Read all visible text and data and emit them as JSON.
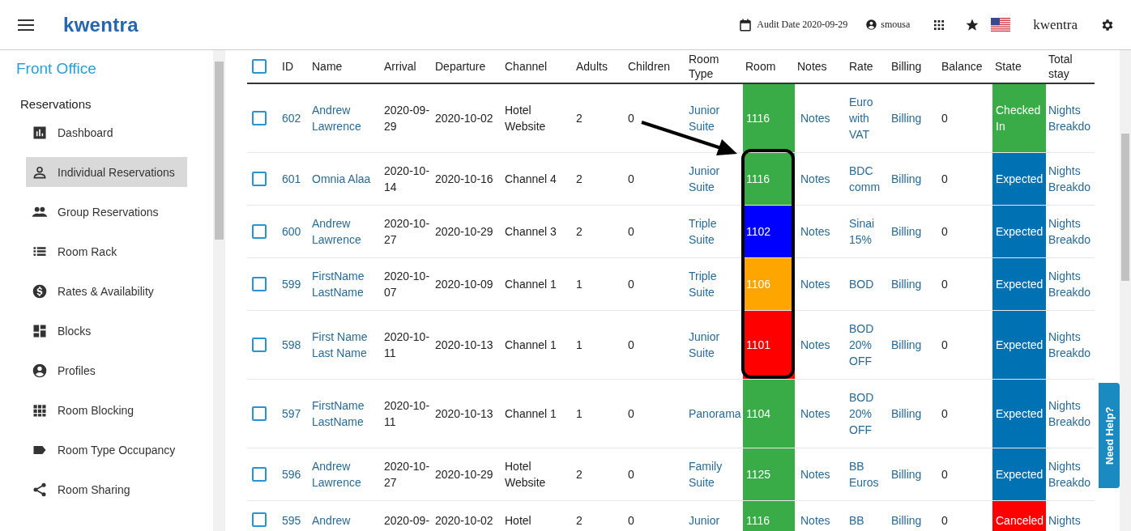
{
  "header": {
    "logo": "kwentra",
    "audit_date": "Audit Date 2020-09-29",
    "user": "smousa",
    "property": "kwentra"
  },
  "sidebar": {
    "section": "Front Office",
    "group": "Reservations",
    "items": [
      {
        "label": "Dashboard",
        "selected": false
      },
      {
        "label": "Individual Reservations",
        "selected": true
      },
      {
        "label": "Group Reservations",
        "selected": false
      },
      {
        "label": "Room Rack",
        "selected": false
      },
      {
        "label": "Rates & Availability",
        "selected": false
      },
      {
        "label": "Blocks",
        "selected": false
      },
      {
        "label": "Profiles",
        "selected": false
      },
      {
        "label": "Room Blocking",
        "selected": false
      },
      {
        "label": "Room Type Occupancy",
        "selected": false
      },
      {
        "label": "Room Sharing",
        "selected": false
      }
    ]
  },
  "table": {
    "select_all_checked": false,
    "columns": [
      "ID",
      "Name",
      "Arrival",
      "Departure",
      "Channel",
      "Adults",
      "Children",
      "Room Type",
      "Room",
      "Notes",
      "Rate",
      "Billing",
      "Balance",
      "State",
      "Total stay"
    ],
    "rows": [
      {
        "checked": false,
        "id": "602",
        "name": "Andrew Lawrence",
        "arrival": "2020-09-29",
        "departure": "2020-10-02",
        "channel": "Hotel Website",
        "adults": "2",
        "children": "0",
        "room_type": "Junior Suite",
        "room": "1116",
        "color": "#39ac48",
        "notes": "Notes",
        "rate": "Euro with VAT",
        "billing": "Billing",
        "balance": "0",
        "state": "Checked In",
        "kind": "checked_in",
        "total_stay": "Nights Breakdo"
      },
      {
        "checked": false,
        "id": "601",
        "name": "Omnia Alaa",
        "arrival": "2020-10-14",
        "departure": "2020-10-16",
        "channel": "Channel 4",
        "adults": "2",
        "children": "0",
        "room_type": "Junior Suite",
        "room": "1116",
        "color": "#39ac48",
        "notes": "Notes",
        "rate": "BDC comm",
        "billing": "Billing",
        "balance": "0",
        "state": "Expected",
        "kind": "expected",
        "total_stay": "Nights Breakdo"
      },
      {
        "checked": false,
        "id": "600",
        "name": "Andrew Lawrence",
        "arrival": "2020-10-27",
        "departure": "2020-10-29",
        "channel": "Channel 3",
        "adults": "2",
        "children": "0",
        "room_type": "Triple Suite",
        "room": "1102",
        "color": "#0000ff",
        "notes": "Notes",
        "rate": "Sinai 15%",
        "billing": "Billing",
        "balance": "0",
        "state": "Expected",
        "kind": "expected",
        "total_stay": "Nights Breakdo"
      },
      {
        "checked": false,
        "id": "599",
        "name": "FirstName LastName",
        "arrival": "2020-10-07",
        "departure": "2020-10-09",
        "channel": "Channel 1",
        "adults": "1",
        "children": "0",
        "room_type": "Triple Suite",
        "room": "1106",
        "color": "#ffa500",
        "notes": "Notes",
        "rate": "BOD",
        "billing": "Billing",
        "balance": "0",
        "state": "Expected",
        "kind": "expected",
        "total_stay": "Nights Breakdo"
      },
      {
        "checked": false,
        "id": "598",
        "name": "First Name Last Name",
        "arrival": "2020-10-11",
        "departure": "2020-10-13",
        "channel": "Channel 1",
        "adults": "1",
        "children": "0",
        "room_type": "Junior Suite",
        "room": "1101",
        "color": "#ff0000",
        "notes": "Notes",
        "rate": "BOD 20% OFF",
        "billing": "Billing",
        "balance": "0",
        "state": "Expected",
        "kind": "expected",
        "total_stay": "Nights Breakdo"
      },
      {
        "checked": false,
        "id": "597",
        "name": "FirstName LastName",
        "arrival": "2020-10-11",
        "departure": "2020-10-13",
        "channel": "Channel 1",
        "adults": "1",
        "children": "0",
        "room_type": "Panorama",
        "room": "1104",
        "color": "#39ac48",
        "notes": "Notes",
        "rate": "BOD 20% OFF",
        "billing": "Billing",
        "balance": "0",
        "state": "Expected",
        "kind": "expected",
        "total_stay": "Nights Breakdo"
      },
      {
        "checked": false,
        "id": "596",
        "name": "Andrew Lawrence",
        "arrival": "2020-10-27",
        "departure": "2020-10-29",
        "channel": "Hotel Website",
        "adults": "2",
        "children": "0",
        "room_type": "Family Suite",
        "room": "1125",
        "color": "#39ac48",
        "notes": "Notes",
        "rate": "BB Euros",
        "billing": "Billing",
        "balance": "0",
        "state": "Expected",
        "kind": "expected",
        "total_stay": "Nights Breakdo"
      },
      {
        "checked": false,
        "id": "595",
        "name": "Andrew",
        "arrival": "2020-09-",
        "departure": "2020-10-02",
        "channel": "Hotel",
        "adults": "2",
        "children": "0",
        "room_type": "Junior",
        "room": "1116",
        "color": "#39ac48",
        "notes": "Notes",
        "rate": "BB",
        "billing": "Billing",
        "balance": "0",
        "state": "Canceled",
        "kind": "canceled",
        "total_stay": "Nights"
      }
    ]
  },
  "help_tab": "Need Help?"
}
